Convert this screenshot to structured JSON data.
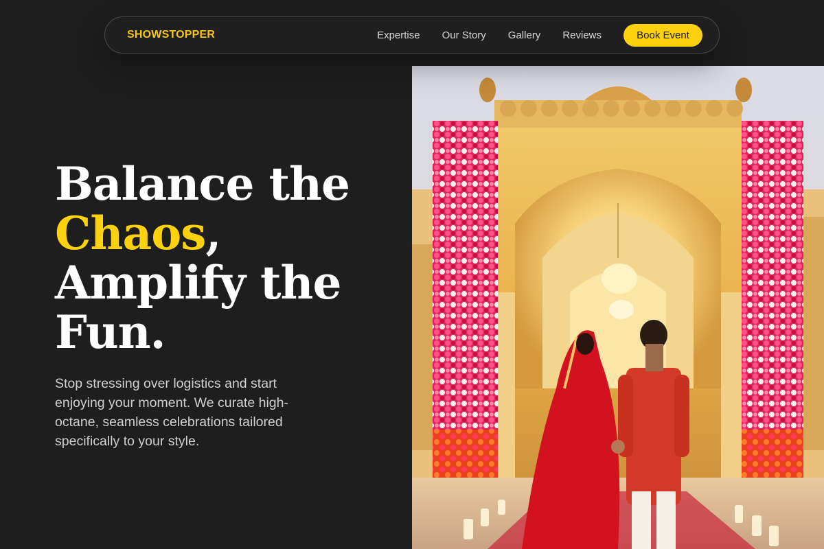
{
  "nav": {
    "brand": "SHOWSTOPPER",
    "links": [
      "Expertise",
      "Our Story",
      "Gallery",
      "Reviews"
    ],
    "cta": "Book Event"
  },
  "hero": {
    "headline_part1": "Balance the",
    "headline_accent": "Chaos",
    "headline_comma": ",",
    "headline_part2": "Amplify the",
    "headline_part3": "Fun.",
    "subtext": "Stop stressing over logistics and start enjoying your moment. We curate high-octane, seamless celebrations tailored specifically to your style."
  },
  "colors": {
    "accent": "#fcd20f",
    "background": "#1e1e1e"
  },
  "photo": {
    "subject": "wedding-couple-photo"
  }
}
